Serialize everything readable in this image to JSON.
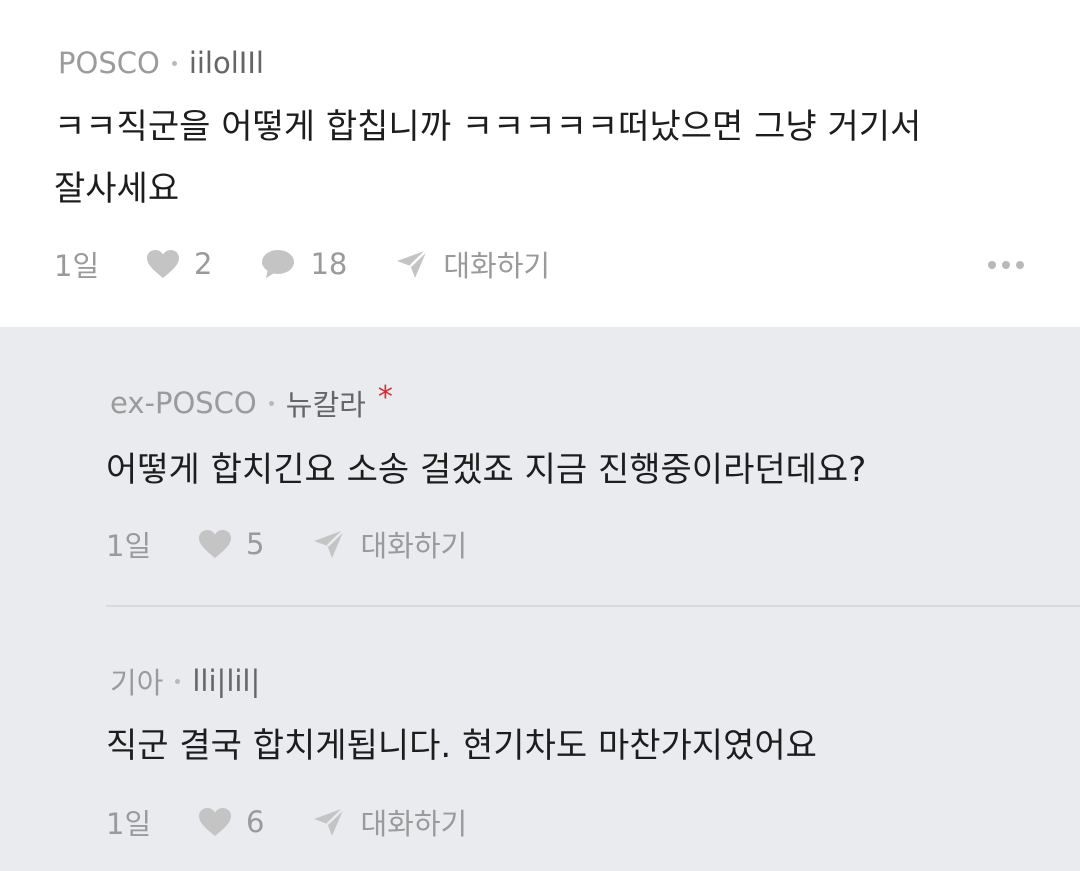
{
  "main_comment": {
    "company": "POSCO",
    "nickname": "iilolIIl",
    "text_line1": "ㅋㅋ직군을 어떻게 합칩니까 ㅋㅋㅋㅋㅋ떠났으면 그냥 거기서",
    "text_line2": "잘사세요",
    "time": "1일",
    "likes": "2",
    "comments": "18",
    "chat_label": "대화하기"
  },
  "replies": [
    {
      "company": "ex-POSCO",
      "nickname": "뉴칼라",
      "badge": "*",
      "text": "어떻게 합치긴요 소송 걸겠죠 지금 진행중이라던데요?",
      "time": "1일",
      "likes": "5",
      "chat_label": "대화하기"
    },
    {
      "company": "기아",
      "nickname": "lli|lil|",
      "text": "직군 결국 합치게됩니다. 현기차도 마찬가지였어요",
      "time": "1일",
      "likes": "6",
      "chat_label": "대화하기"
    }
  ],
  "colors": {
    "reply_background": "#eaebef",
    "badge_red": "#d32f2f",
    "icon_gray": "#c4c4c4"
  }
}
